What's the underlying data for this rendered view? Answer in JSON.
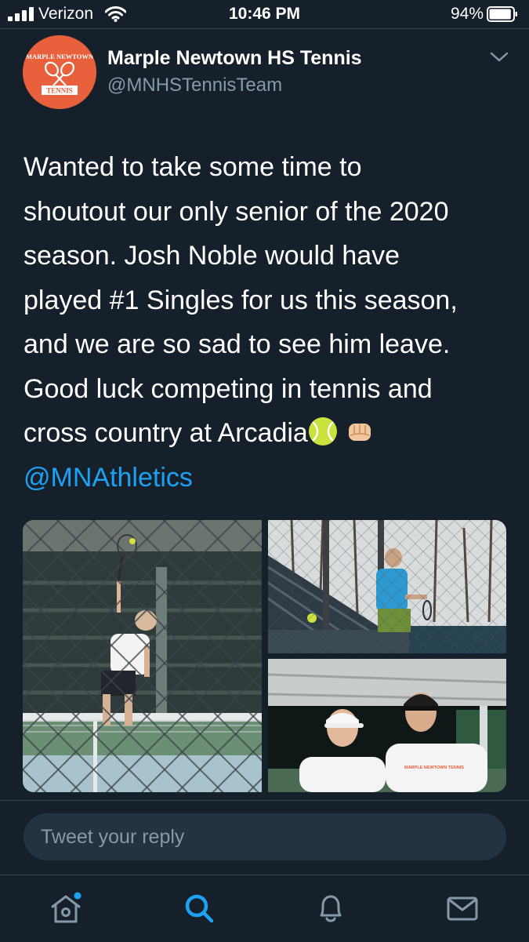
{
  "status_bar": {
    "carrier": "Verizon",
    "time": "10:46 PM",
    "battery_percent": "94%",
    "battery_level": 0.94
  },
  "tweet": {
    "display_name": "Marple Newtown HS Tennis",
    "handle": "@MNHSTennisTeam",
    "avatar_text_top": "MARPLE NEWTOWN",
    "avatar_text_bottom": "TENNIS",
    "text_lines": [
      "Wanted to take some time to",
      "shoutout our only senior of the 2020",
      "season. Josh Noble would have",
      "played #1 Singles for us this season,",
      "and we are so sad to see him leave.",
      "Good luck competing in tennis and",
      "cross country at Arcadia"
    ],
    "emojis": [
      "tennis-ball",
      "oncoming-fist"
    ],
    "mention": "@MNAthletics",
    "photos": [
      {
        "subject": "player serving behind fence"
      },
      {
        "subject": "player hitting forehand outdoors"
      },
      {
        "subject": "two players posing indoors",
        "shirt_text": "MARPLE NEWTOWN TENNIS"
      }
    ]
  },
  "reply": {
    "placeholder": "Tweet your reply"
  },
  "nav": {
    "items": [
      "home-icon",
      "search-icon",
      "notifications-icon",
      "messages-icon"
    ],
    "active": "search-icon",
    "home_has_new": true
  },
  "colors": {
    "background": "#15202b",
    "accent": "#1da1f2",
    "secondary_text": "#8899a6",
    "avatar_bg": "#e8603c"
  }
}
